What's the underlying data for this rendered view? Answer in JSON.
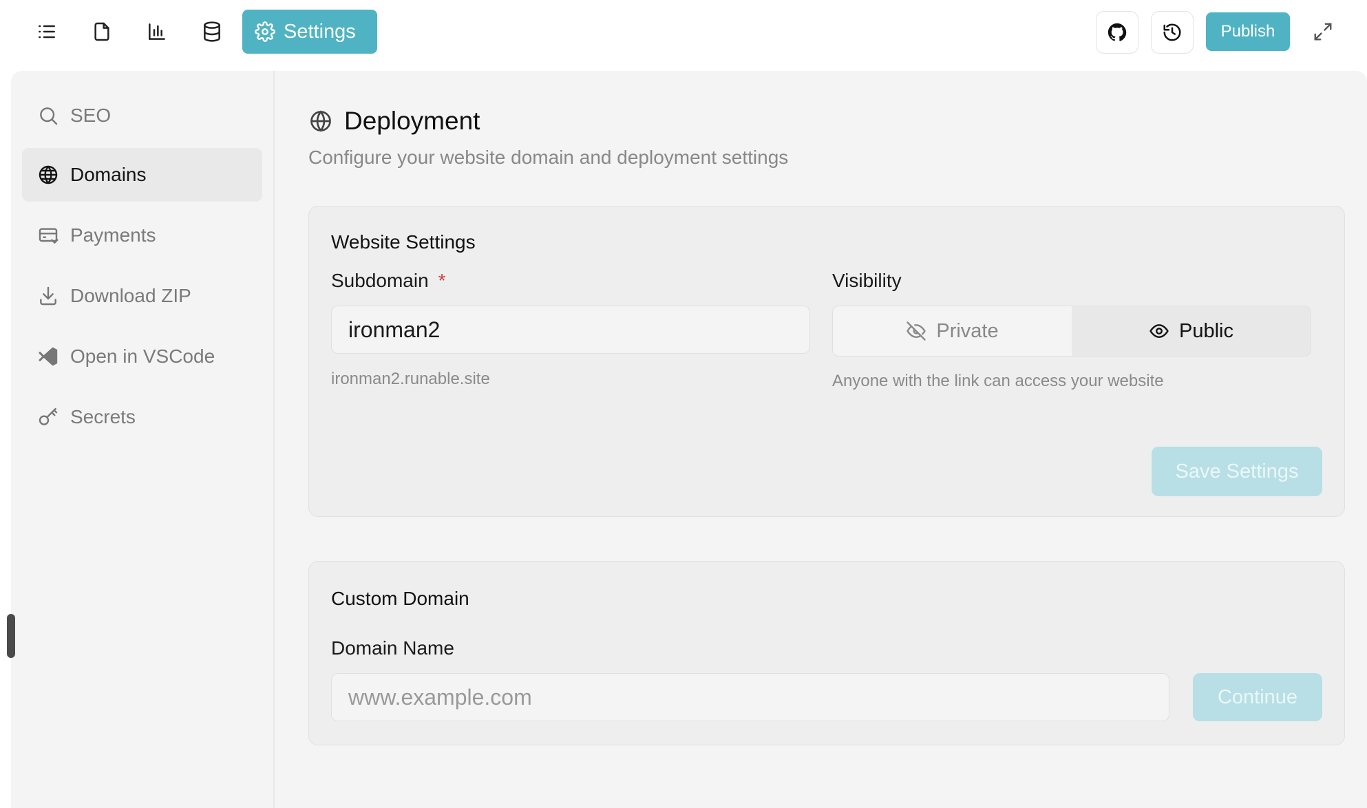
{
  "toolbar": {
    "icons": [
      "list-icon",
      "file-icon",
      "chart-icon",
      "database-icon"
    ],
    "settings_label": "Settings",
    "publish_label": "Publish",
    "accent_color": "#4fb3c3"
  },
  "sidebar": {
    "items": [
      {
        "label": "SEO",
        "icon": "search-icon",
        "active": false
      },
      {
        "label": "Domains",
        "icon": "globe-icon",
        "active": true
      },
      {
        "label": "Payments",
        "icon": "payment-card-icon",
        "active": false
      },
      {
        "label": "Download ZIP",
        "icon": "download-icon",
        "active": false
      },
      {
        "label": "Open in VSCode",
        "icon": "vscode-icon",
        "active": false
      },
      {
        "label": "Secrets",
        "icon": "key-icon",
        "active": false
      }
    ]
  },
  "main": {
    "title": "Deployment",
    "subtitle": "Configure your website domain and deployment settings",
    "website_settings": {
      "title": "Website Settings",
      "subdomain_label": "Subdomain",
      "required_mark": "*",
      "subdomain_value": "ironman2",
      "subdomain_hint": "ironman2.runable.site",
      "visibility_label": "Visibility",
      "visibility_options": [
        "Private",
        "Public"
      ],
      "visibility_selected": "Public",
      "visibility_hint": "Anyone with the link can access your website",
      "save_label": "Save Settings"
    },
    "custom_domain": {
      "title": "Custom Domain",
      "domain_label": "Domain Name",
      "domain_placeholder": "www.example.com",
      "domain_value": "",
      "continue_label": "Continue"
    }
  }
}
